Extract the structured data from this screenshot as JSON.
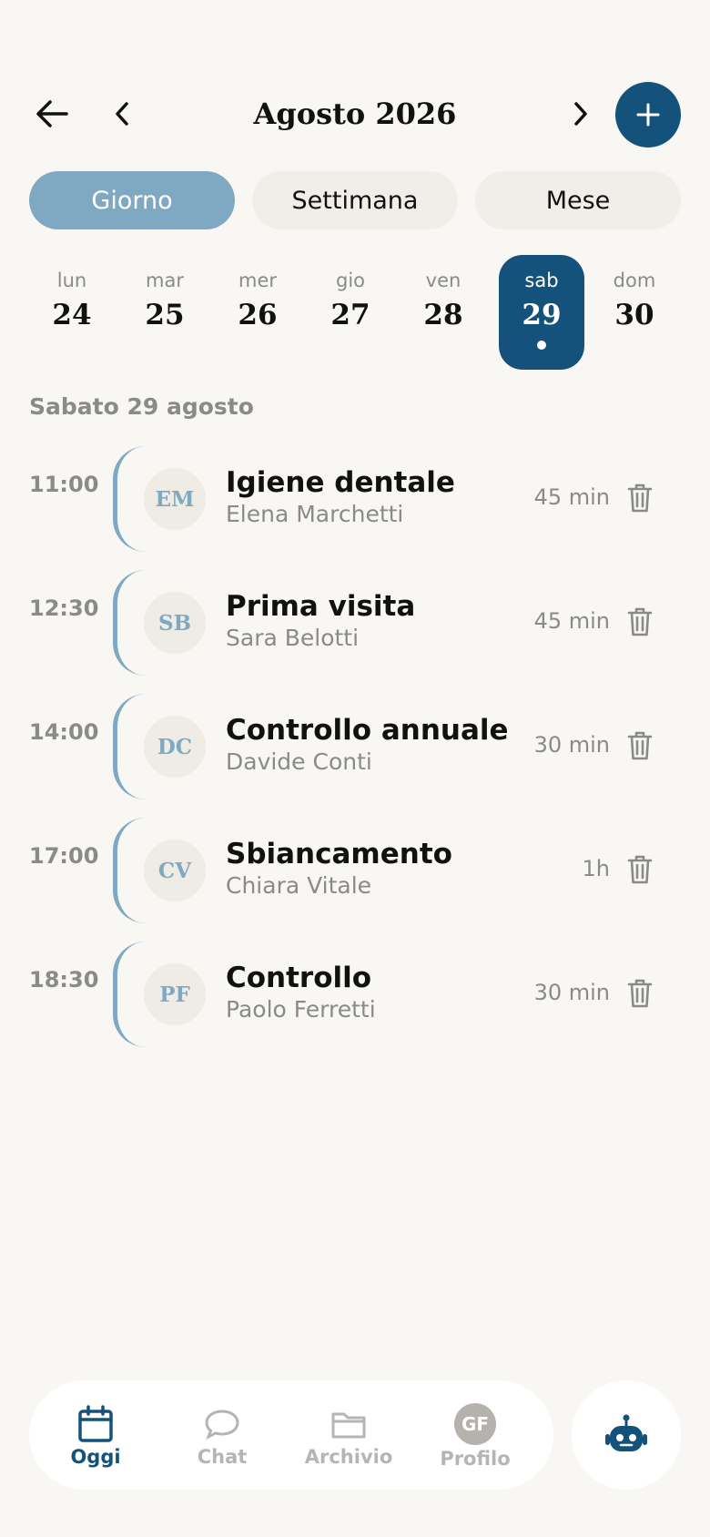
{
  "header": {
    "title": "Agosto 2026",
    "back_icon": "arrow-left-icon",
    "prev_icon": "chevron-left-icon",
    "next_icon": "chevron-right-icon",
    "add_icon": "plus-icon"
  },
  "view_tabs": [
    {
      "label": "Giorno",
      "active": true
    },
    {
      "label": "Settimana",
      "active": false
    },
    {
      "label": "Mese",
      "active": false
    }
  ],
  "days": [
    {
      "name": "lun",
      "num": "24"
    },
    {
      "name": "mar",
      "num": "25"
    },
    {
      "name": "mer",
      "num": "26"
    },
    {
      "name": "gio",
      "num": "27"
    },
    {
      "name": "ven",
      "num": "28"
    },
    {
      "name": "sab",
      "num": "29",
      "selected": true
    },
    {
      "name": "dom",
      "num": "30"
    }
  ],
  "date_label": "Sabato 29 agosto",
  "appointments": [
    {
      "time": "11:00",
      "initials": "EM",
      "title": "Igiene dentale",
      "patient": "Elena Marchetti",
      "duration": "45 min"
    },
    {
      "time": "12:30",
      "initials": "SB",
      "title": "Prima visita",
      "patient": "Sara Belotti",
      "duration": "45 min"
    },
    {
      "time": "14:00",
      "initials": "DC",
      "title": "Controllo annuale",
      "patient": "Davide Conti",
      "duration": "30 min"
    },
    {
      "time": "17:00",
      "initials": "CV",
      "title": "Sbiancamento",
      "patient": "Chiara Vitale",
      "duration": "1h"
    },
    {
      "time": "18:30",
      "initials": "PF",
      "title": "Controllo",
      "patient": "Paolo Ferretti",
      "duration": "30 min"
    }
  ],
  "nav": {
    "items": [
      {
        "label": "Oggi",
        "icon": "calendar-icon",
        "active": true
      },
      {
        "label": "Chat",
        "icon": "chat-bubble-icon",
        "active": false
      },
      {
        "label": "Archivio",
        "icon": "folder-icon",
        "active": false
      },
      {
        "label": "Profilo",
        "icon": "avatar",
        "initials": "GF",
        "active": false
      }
    ],
    "assistant_icon": "robot-icon"
  },
  "colors": {
    "primary": "#14527b",
    "accent": "#7fa9c3",
    "background": "#f9f7f3",
    "muted": "#8a8a8a"
  }
}
